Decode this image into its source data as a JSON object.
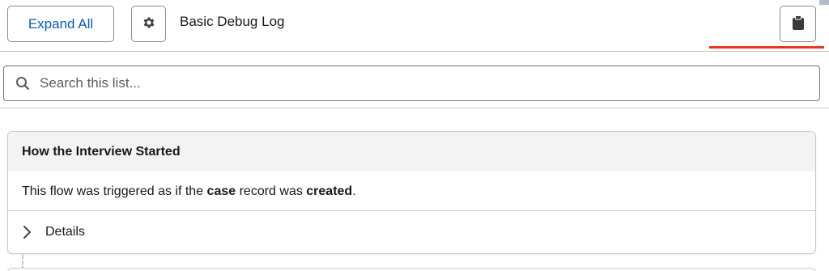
{
  "toolbar": {
    "expand_label": "Expand All",
    "title": "Basic Debug Log",
    "gear_icon": "gear-icon",
    "clipboard_icon": "clipboard-icon",
    "active_color": "#e4371f"
  },
  "search": {
    "placeholder": "Search this list...",
    "value": ""
  },
  "card": {
    "title": "How the Interview Started",
    "body_prefix": "This flow was triggered as if the ",
    "body_bold_1": "case",
    "body_middle": " record was ",
    "body_bold_2": "created",
    "body_suffix": ".",
    "details_label": "Details"
  }
}
